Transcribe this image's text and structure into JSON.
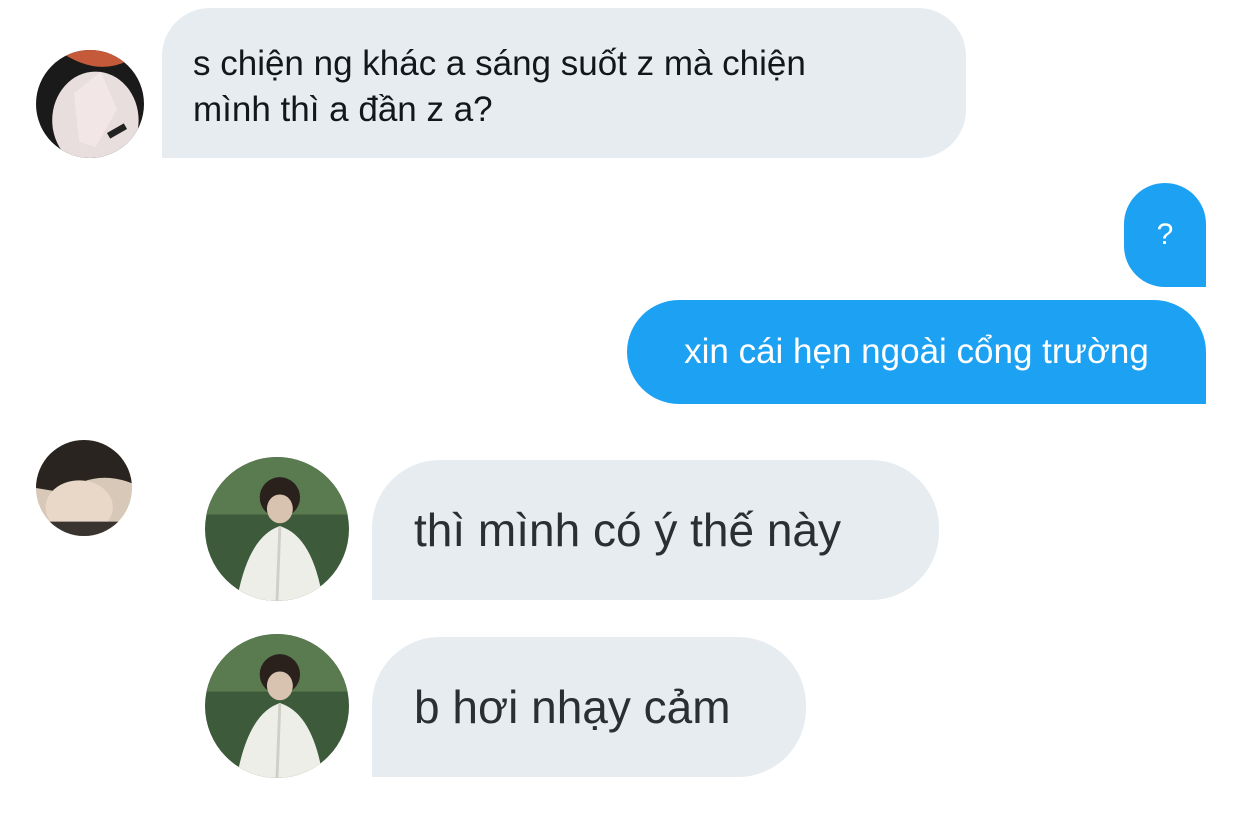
{
  "conversation": {
    "messages": [
      {
        "sender": "other",
        "text_lines": [
          "s chiện ng khác a sáng suốt z mà chiện",
          "mình thì a đần z a?"
        ]
      },
      {
        "sender": "me",
        "text": "?"
      },
      {
        "sender": "me",
        "text": "xin cái hẹn ngoài cổng trường"
      },
      {
        "sender": "other",
        "text": "thì mình có ý thế này"
      },
      {
        "sender": "other",
        "text": "b hơi nhạy cảm"
      }
    ]
  },
  "colors": {
    "incoming_bubble": "#e6ecf0",
    "outgoing_bubble": "#1da1f2",
    "outgoing_text": "#ffffff",
    "incoming_text": "#14171a"
  }
}
